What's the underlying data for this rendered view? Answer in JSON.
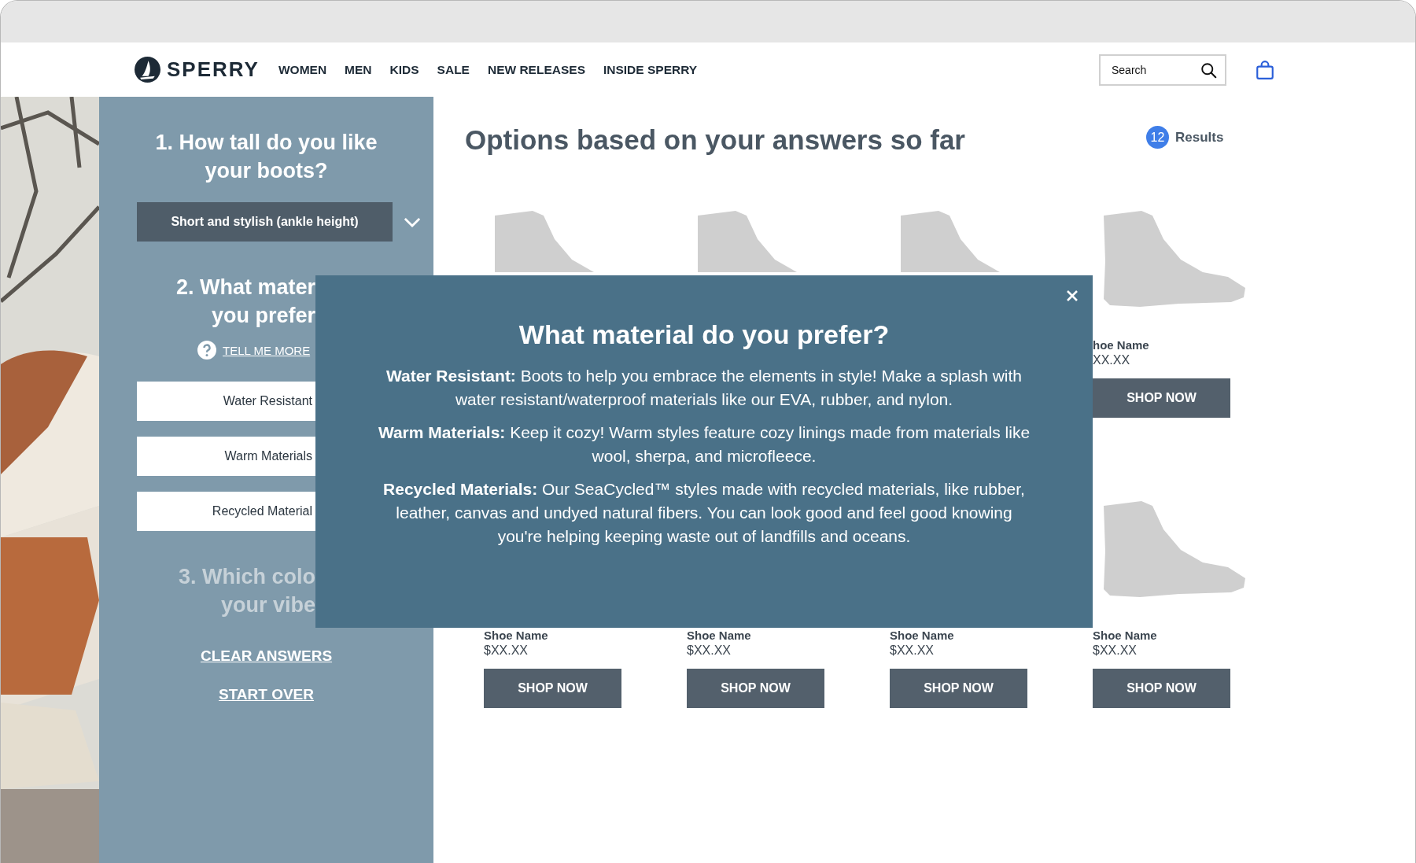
{
  "header": {
    "logo": "SPERRY",
    "nav": [
      "WOMEN",
      "MEN",
      "KIDS",
      "SALE",
      "NEW RELEASES",
      "INSIDE SPERRY"
    ],
    "search": {
      "placeholder": "Search"
    }
  },
  "sidebar": {
    "questions": [
      {
        "kind": "dropdown",
        "lines": [
          "1. How tall do you like",
          "your boots?"
        ],
        "disabled": false,
        "value": "Short and stylish (ankle height)"
      },
      {
        "kind": "options",
        "lines": [
          "2. What mater",
          "you prefer"
        ],
        "disabled": false,
        "help": "TELL ME MORE",
        "options": [
          "Water Resistant",
          "Warm Materials",
          "Recycled Material"
        ]
      },
      {
        "kind": "colors",
        "lines": [
          "3. Which colo",
          "your vibe"
        ],
        "disabled": true
      }
    ],
    "links": [
      "CLEAR ANSWERS",
      "START OVER"
    ]
  },
  "main": {
    "title": "Options based on your answers so far",
    "results_count": "12",
    "results_label": "Results",
    "products": [
      {
        "kind": "covered-top"
      },
      {
        "kind": "covered-top"
      },
      {
        "kind": "covered-top"
      },
      {
        "kind": "full",
        "name": "hoe Name",
        "price": "XX.XX",
        "button": "SHOP NOW"
      },
      {
        "kind": "covered-image",
        "name": "Shoe Name",
        "price": "$XX.XX",
        "button": "SHOP NOW"
      },
      {
        "kind": "covered-image",
        "name": "Shoe Name",
        "price": "$XX.XX",
        "button": "SHOP NOW"
      },
      {
        "kind": "covered-image",
        "name": "Shoe Name",
        "price": "$XX.XX",
        "button": "SHOP NOW"
      },
      {
        "kind": "full",
        "name": "Shoe Name",
        "price": "$XX.XX",
        "button": "SHOP NOW"
      }
    ]
  },
  "modal": {
    "title": "What material do you prefer?",
    "paragraphs": [
      "**Water Resistant:** Boots to help you embrace the elements in style! Make a splash with water resistant/waterproof materials like our EVA, rubber, and nylon.",
      "**Warm Materials:** Keep it cozy! Warm styles feature cozy linings made from materials like wool, sherpa, and microfleece.",
      "**Recycled Materials:** Our SeaCycled™ styles made with recycled materials, like rubber, leather, canvas and undyed natural fibers. You can look good and feel good knowing you're helping keeping waste out of landfills and oceans."
    ]
  }
}
